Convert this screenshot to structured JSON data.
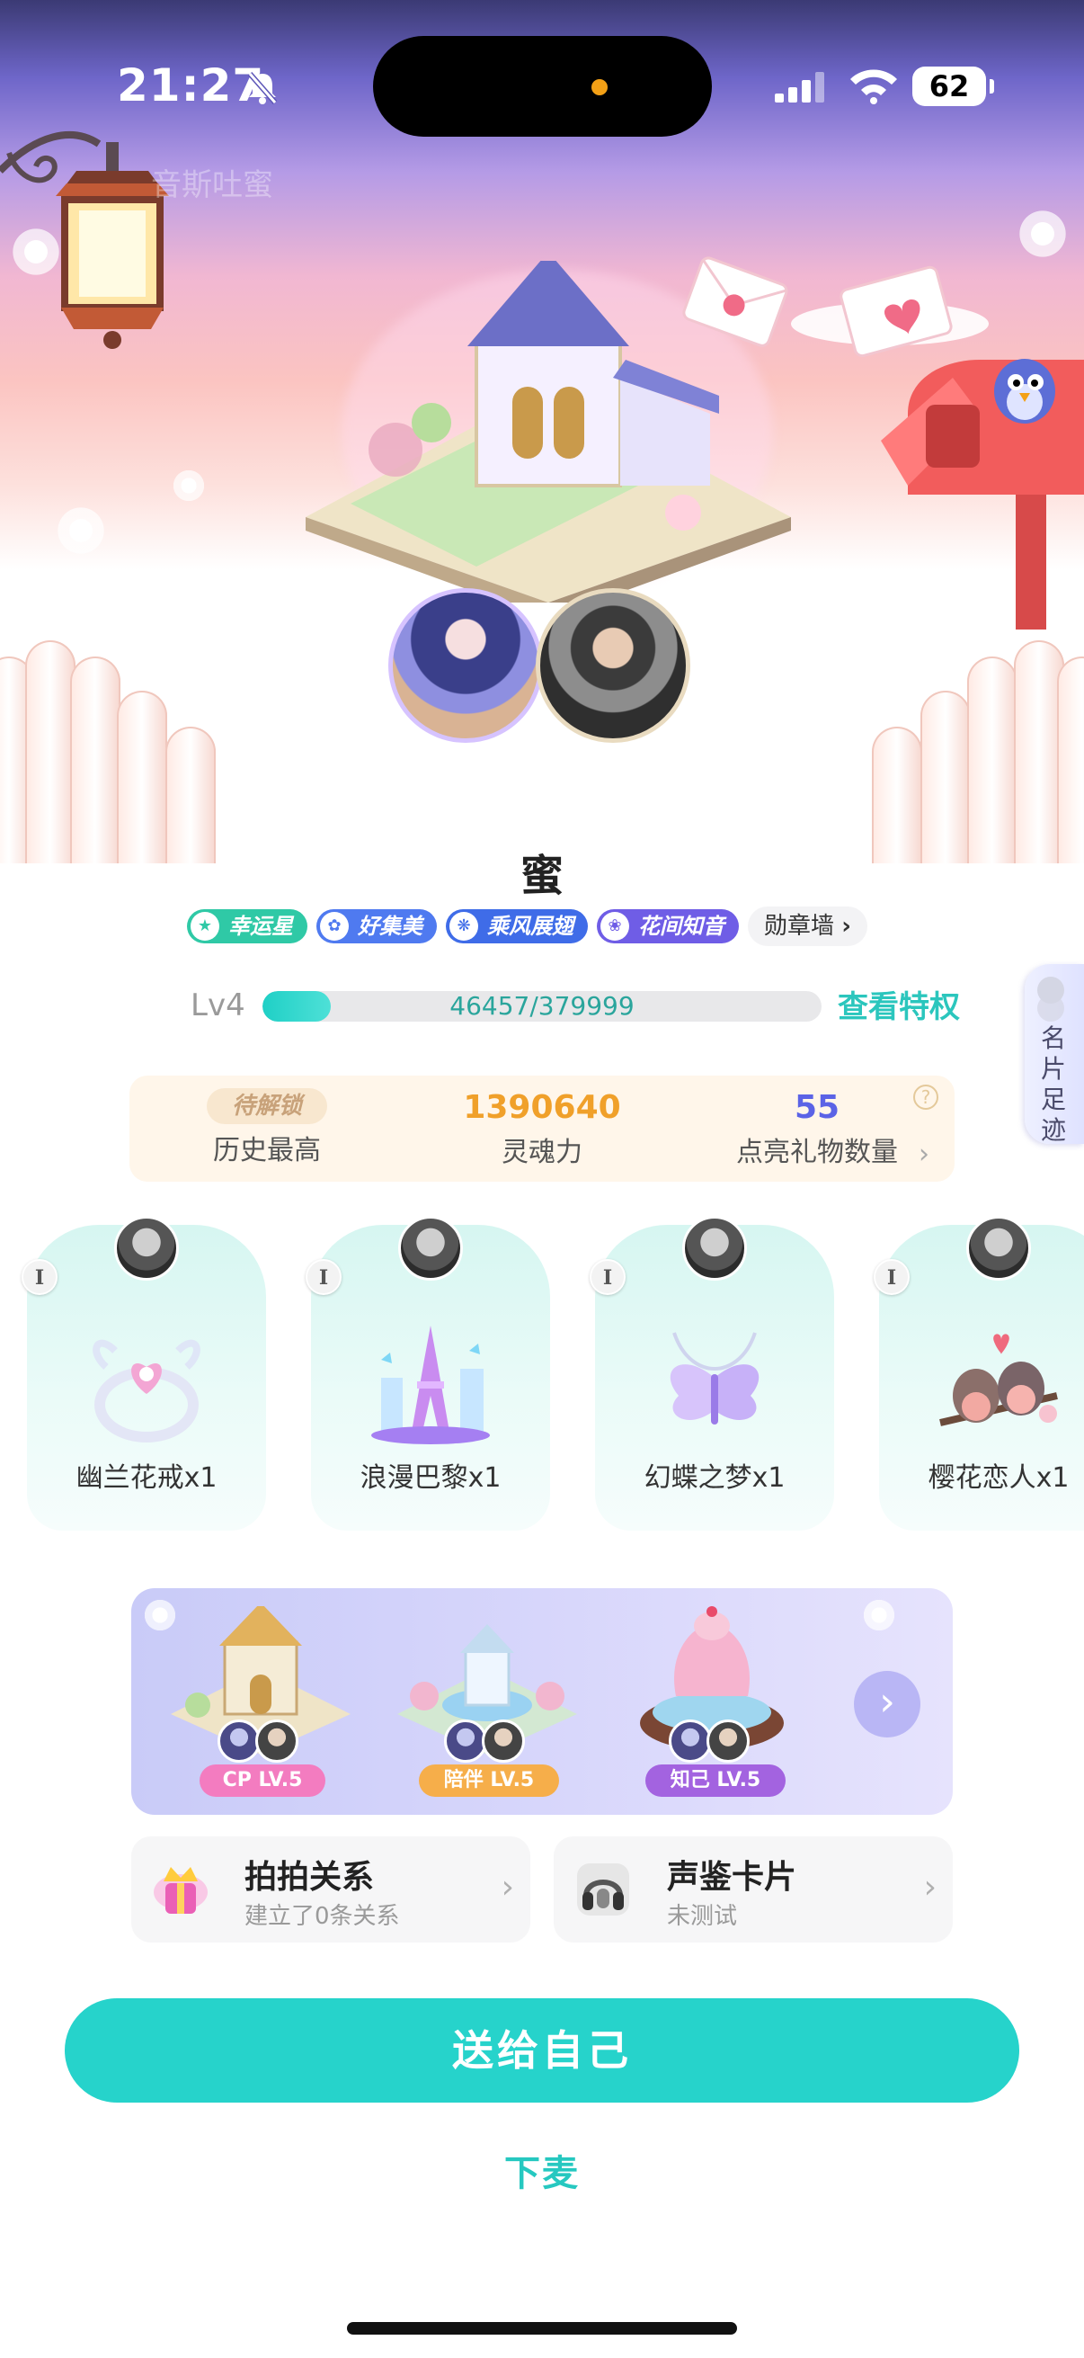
{
  "status_bar": {
    "time": "21:27",
    "battery": "62",
    "icons": [
      "bell-slash-icon",
      "signal-icon",
      "wifi-icon",
      "battery-icon"
    ]
  },
  "hero": {
    "faded_title": "音斯吐蜜"
  },
  "profile": {
    "name": "蜜",
    "badges": [
      {
        "label": "幸运星",
        "color": "#2fc9a6",
        "icon": "star-icon"
      },
      {
        "label": "好集美",
        "color": "#4f7af0",
        "icon": "flower-icon"
      },
      {
        "label": "乘风展翅",
        "color": "#3f6ce8",
        "icon": "wing-icon"
      },
      {
        "label": "花间知音",
        "color": "#6f5de6",
        "icon": "music-flower-icon"
      }
    ],
    "medal_wall": "勋章墙"
  },
  "level": {
    "label": "Lv4",
    "progress_text": "46457/379999",
    "progress_fraction": 0.122,
    "privilege_link": "查看特权"
  },
  "side_tab": {
    "label": "名片足迹"
  },
  "stats": {
    "locked_label": "待解锁",
    "history_label": "历史最高",
    "soul_value": "1390640",
    "soul_label": "灵魂力",
    "gifts_value": "55",
    "gifts_label": "点亮礼物数量",
    "soul_color": "#f0a02a",
    "gifts_color": "#5b63e6"
  },
  "gifts": [
    {
      "name": "幽兰花戒x1",
      "level": "I",
      "icon": "ring-icon"
    },
    {
      "name": "浪漫巴黎x1",
      "level": "I",
      "icon": "eiffel-tower-icon"
    },
    {
      "name": "幻蝶之梦x1",
      "level": "I",
      "icon": "butterfly-necklace-icon"
    },
    {
      "name": "樱花恋人x1",
      "level": "I",
      "icon": "lovebirds-icon"
    }
  ],
  "relationships": [
    {
      "label": "CP LV.5",
      "color": "#f37cc0"
    },
    {
      "label": "陪伴 LV.5",
      "color": "#f6ae4a"
    },
    {
      "label": "知己 LV.5",
      "color": "#a363e0"
    }
  ],
  "cards": [
    {
      "title": "拍拍关系",
      "subtitle": "建立了0条关系",
      "icon": "crown-gift-icon"
    },
    {
      "title": "声鉴卡片",
      "subtitle": "未测试",
      "icon": "headphones-icon"
    }
  ],
  "actions": {
    "primary": "送给自己",
    "secondary": "下麦"
  }
}
